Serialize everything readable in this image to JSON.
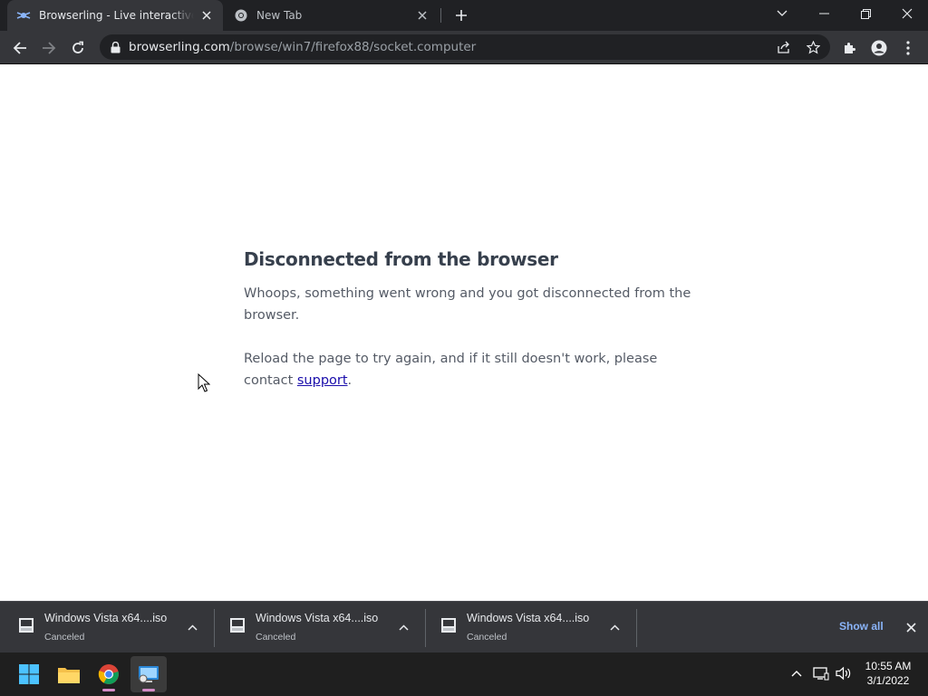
{
  "browser": {
    "tabs": [
      {
        "title": "Browserling - Live interactive cro",
        "active": true,
        "favicon": "browserling-icon"
      },
      {
        "title": "New Tab",
        "active": false,
        "favicon": "chrome-icon"
      }
    ],
    "url": {
      "host": "browserling.com",
      "path": "/browse/win7/firefox88/socket.computer"
    }
  },
  "content": {
    "heading": "Disconnected from the browser",
    "paragraph1": "Whoops, something went wrong and you got disconnected from the browser.",
    "paragraph2_before": "Reload the page to try again, and if it still doesn't work, please contact ",
    "paragraph2_link": "support",
    "paragraph2_after": "."
  },
  "downloads": {
    "items": [
      {
        "filename": "Windows Vista x64....iso",
        "status": "Canceled"
      },
      {
        "filename": "Windows Vista x64....iso",
        "status": "Canceled"
      },
      {
        "filename": "Windows Vista x64....iso",
        "status": "Canceled"
      }
    ],
    "show_all_label": "Show all"
  },
  "taskbar": {
    "apps": [
      "windows-start-icon",
      "file-explorer-icon",
      "chrome-icon",
      "remote-desktop-icon"
    ],
    "clock": {
      "time": "10:55 AM",
      "date": "3/1/2022"
    }
  },
  "colors": {
    "tab_strip": "#202124",
    "toolbar": "#35363a",
    "link": "#1a0dab",
    "show_all": "#8ab4f8",
    "heading": "#37404d"
  }
}
